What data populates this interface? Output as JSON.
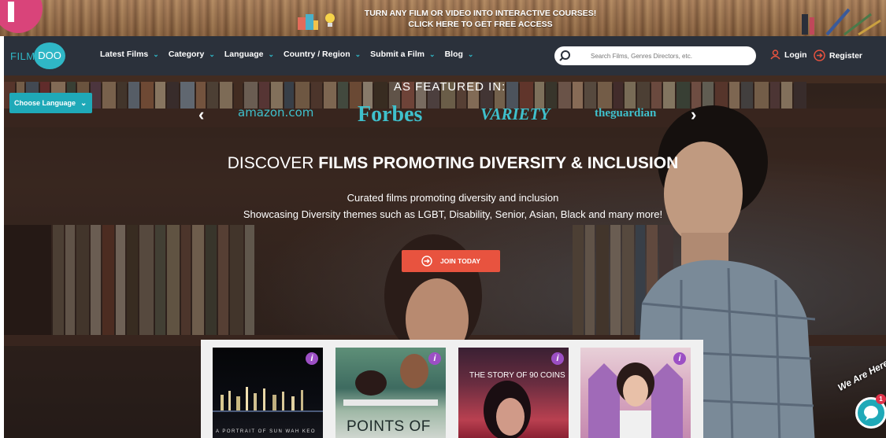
{
  "promo": {
    "line1": "TURN ANY FILM OR VIDEO INTO INTERACTIVE COURSES!",
    "line2": "CLICK HERE TO GET FREE ACCESS"
  },
  "brand": {
    "part1": "FILM",
    "part2": "DOO",
    "color": "#2fb7c6"
  },
  "nav": {
    "items": [
      {
        "label": "Latest Films"
      },
      {
        "label": "Category"
      },
      {
        "label": "Language"
      },
      {
        "label": "Country / Region"
      },
      {
        "label": "Submit a Film"
      },
      {
        "label": "Blog"
      }
    ],
    "search_placeholder": "Search Films, Genres Directors, etc.",
    "login": "Login",
    "register": "Register"
  },
  "hero": {
    "choose_language": "Choose Language",
    "featured": "AS  FEATURED  IN:",
    "press": [
      "amazon.com",
      "Forbes",
      "VARIETY",
      "theguardian"
    ],
    "headline_light": "DISCOVER ",
    "headline_bold": "FILMS PROMOTING DIVERSITY & INCLUSION",
    "sub1": "Curated films promoting diversity and inclusion",
    "sub2": "Showcasing Diversity themes such as LGBT, Disability, Senior, Asian, Black and many more!",
    "cta": "JOIN TODAY",
    "cta_color": "#e8533f"
  },
  "films": {
    "card1_caption": "A PORTRAIT OF SUN WAH KEO",
    "card2_title": "POINTS OF",
    "card3_title": "THE STORY OF 90 COINS",
    "info_icon": "i"
  },
  "chat": {
    "label": "We Are Here",
    "count": "1"
  },
  "colors": {
    "accent": "#1fa9b8",
    "nav_bg": "#2b313b",
    "info_badge": "#9c4fc4"
  }
}
